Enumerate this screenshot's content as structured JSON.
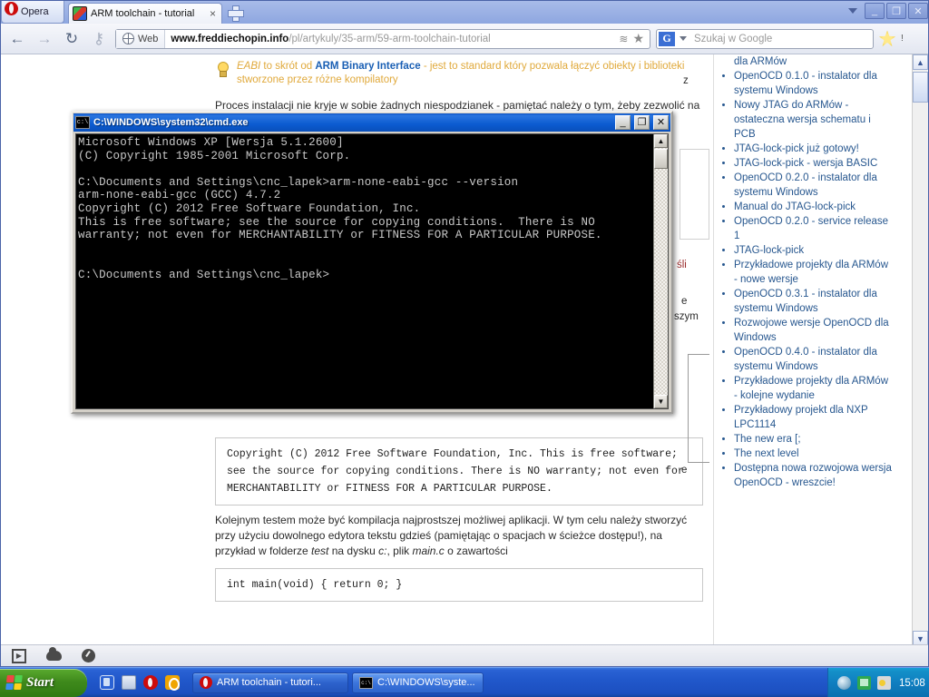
{
  "browser": {
    "app_name": "Opera",
    "tab": {
      "title": "ARM toolchain - tutorial",
      "close_label": "×",
      "favicon": "opera-page-favicon"
    },
    "new_tab_label": "+",
    "window_controls": {
      "dropdown": "▾",
      "minimize": "_",
      "maximize": "❐",
      "close": "✕"
    },
    "toolbar": {
      "back": "←",
      "forward": "→",
      "reload": "↻",
      "key": "⚷",
      "web_chip_label": "Web",
      "url_prefix": "www.freddiechopin.info",
      "url_suffix": "/pl/artykuly/35-arm/59-arm-toolchain-tutorial",
      "rss": "≋",
      "bookmark_star": "★",
      "search_engine": "G",
      "search_caret": "▾",
      "search_placeholder": "Szukaj w Google",
      "opera_star": "opera-star-icon",
      "warn": "!"
    },
    "scrollbar": {
      "up": "▲",
      "down": "▼"
    },
    "statusbar": {
      "icons": [
        "play-icon",
        "cloud-icon",
        "gauge-icon"
      ]
    }
  },
  "page": {
    "note": {
      "term": "EABI",
      "mid": " to skrót od ",
      "bold": "ARM Binary Interface",
      "rest": " - jest to standard który pozwala łączyć obiekty i biblioteki stworzone przez różne kompilatory"
    },
    "para1": "Proces instalacji nie kryje w sobie żadnych niespodzianek - pamiętać należy o tym, żeby zezwolić na zmodyfikowanie zmiennej PATH w systemie, co jest standardowo wybraną opcją.",
    "codeblock1": "Copyright (C) 2012 Free Software Foundation, Inc.\nThis is free software; see the source for copying conditions. There\nis NO\nwarranty; not even for MERCHANTABILITY or FITNESS FOR A PARTICULAR\nPURPOSE.",
    "para2_a": "Kolejnym testem może być kompilacja najprostszej możliwej aplikacji. W tym celu należy stworzyć przy użyciu dowolnego edytora tekstu gdzieś (pamiętając o spacjach w ścieżce dostępu!), na przykład w folderze ",
    "para2_italic1": "test",
    "para2_b": " na dysku ",
    "para2_italic2": "c:",
    "para2_c": ", plik ",
    "para2_italic3": "main.c",
    "para2_d": " o zawartości",
    "codeblock2": "int main(void)\n{\nreturn 0;\n}",
    "fragments": {
      "f1": "z",
      "f2": "śli",
      "f3": "e",
      "f4": "szym",
      "f5": "e"
    },
    "sidebar": {
      "first_item_tail": "dla ARMów",
      "items": [
        "OpenOCD 0.1.0 - instalator dla systemu Windows",
        "Nowy JTAG do ARMów - ostateczna wersja schematu i PCB",
        "JTAG-lock-pick już gotowy!",
        "JTAG-lock-pick - wersja BASIC",
        "OpenOCD 0.2.0 - instalator dla systemu Windows",
        "Manual do JTAG-lock-pick",
        "OpenOCD 0.2.0 - service release 1",
        "JTAG-lock-pick",
        "Przykładowe projekty dla ARMów - nowe wersje",
        "OpenOCD 0.3.1 - instalator dla systemu Windows",
        "Rozwojowe wersje OpenOCD dla Windows",
        "OpenOCD 0.4.0 - instalator dla systemu Windows",
        "Przykładowe projekty dla ARMów - kolejne wydanie",
        "Przykładowy projekt dla NXP LPC1114",
        "The new era [;",
        "The next level",
        "Dostępna nowa rozwojowa wersja OpenOCD - wreszcie!"
      ]
    }
  },
  "cmd_window": {
    "title": "C:\\WINDOWS\\system32\\cmd.exe",
    "icon_label": "c:\\",
    "buttons": {
      "minimize": "_",
      "maximize": "❐",
      "close": "✕"
    },
    "console_text": "Microsoft Windows XP [Wersja 5.1.2600]\n(C) Copyright 1985-2001 Microsoft Corp.\n\nC:\\Documents and Settings\\cnc_lapek>arm-none-eabi-gcc --version\narm-none-eabi-gcc (GCC) 4.7.2\nCopyright (C) 2012 Free Software Foundation, Inc.\nThis is free software; see the source for copying conditions.  There is NO\nwarranty; not even for MERCHANTABILITY or FITNESS FOR A PARTICULAR PURPOSE.\n\n\nC:\\Documents and Settings\\cnc_lapek>",
    "scrollbar": {
      "up": "▲",
      "down": "▼"
    }
  },
  "taskbar": {
    "start_label": "Start",
    "quick_launch": [
      "show-desktop-icon",
      "media-icon",
      "opera-icon",
      "image-viewer-icon"
    ],
    "items": [
      {
        "label": "ARM toolchain - tutori...",
        "icon": "opera-icon"
      },
      {
        "label": "C:\\WINDOWS\\syste...",
        "icon": "cmd-icon"
      }
    ],
    "tray": {
      "icons": [
        "volume-icon",
        "network-icon",
        "power-icon"
      ],
      "clock": "15:08"
    }
  },
  "colors": {
    "taskbar_blue": "#2158cb",
    "start_green": "#3f8a1c",
    "title_blue": "#0b5bd0",
    "link_blue": "#27578f",
    "note_orange": "#e0a93b",
    "console_bg": "#000000",
    "console_fg": "#c8c8c8"
  }
}
